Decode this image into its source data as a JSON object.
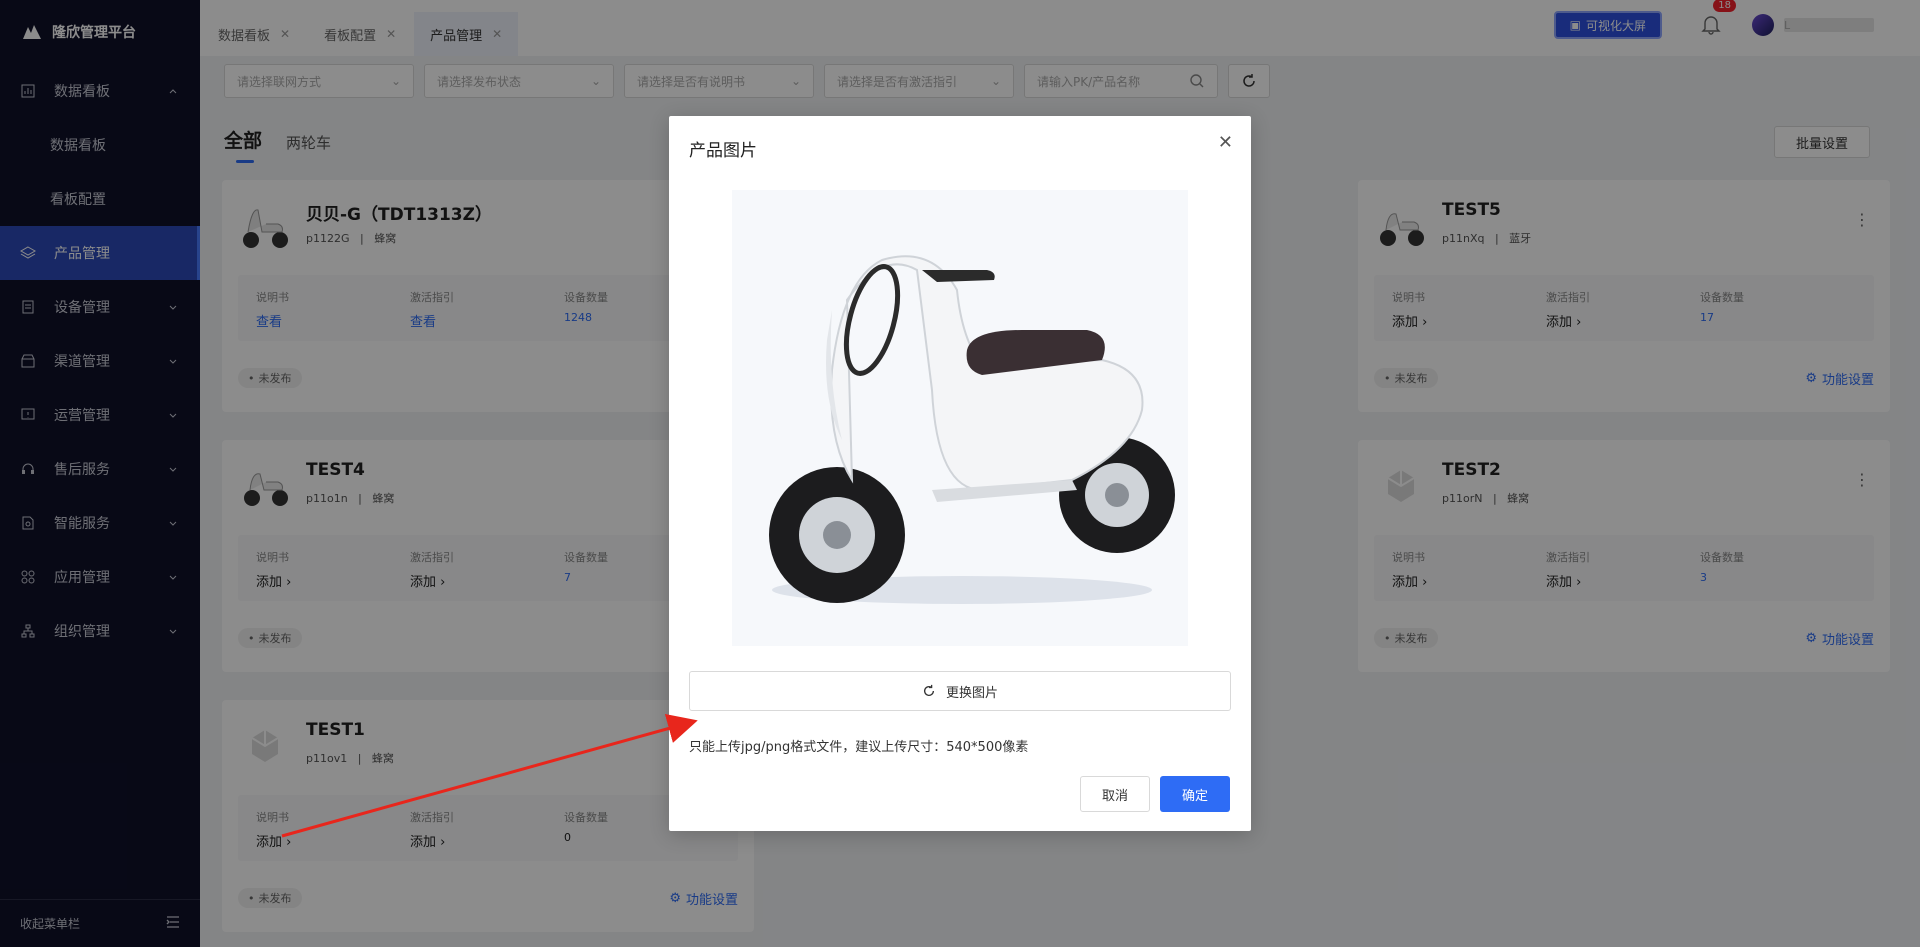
{
  "app": {
    "title": "隆欣管理平台"
  },
  "sidebar": {
    "items": [
      {
        "label": "数据看板",
        "icon": "chart-icon",
        "expanded": true
      },
      {
        "label": "数据看板",
        "sub": true
      },
      {
        "label": "看板配置",
        "sub": true
      },
      {
        "label": "产品管理",
        "icon": "layers-icon",
        "active": true
      },
      {
        "label": "设备管理",
        "icon": "device-icon"
      },
      {
        "label": "渠道管理",
        "icon": "store-icon"
      },
      {
        "label": "运营管理",
        "icon": "ops-icon"
      },
      {
        "label": "售后服务",
        "icon": "headset-icon"
      },
      {
        "label": "智能服务",
        "icon": "doc-icon"
      },
      {
        "label": "应用管理",
        "icon": "apps-icon"
      },
      {
        "label": "组织管理",
        "icon": "org-icon"
      }
    ],
    "collapse_label": "收起菜单栏"
  },
  "tabs": [
    {
      "label": "数据看板"
    },
    {
      "label": "看板配置"
    },
    {
      "label": "产品管理",
      "active": true
    }
  ],
  "header": {
    "bigscreen_label": "可视化大屏",
    "notification_count": "18",
    "username": "L"
  },
  "filters": {
    "network_placeholder": "请选择联网方式",
    "publish_placeholder": "请选择发布状态",
    "manual_placeholder": "请选择是否有说明书",
    "guide_placeholder": "请选择是否有激活指引",
    "search_placeholder": "请输入PK/产品名称"
  },
  "categories": [
    {
      "label": "全部",
      "active": true
    },
    {
      "label": "两轮车"
    }
  ],
  "batch_label": "批量设置",
  "card_labels": {
    "manual": "说明书",
    "guide": "激活指引",
    "devices": "设备数量",
    "func": "功能设置"
  },
  "cards": [
    {
      "name": "贝贝-G（TDT1313Z）",
      "pk": "p1122G",
      "network": "蜂窝",
      "manual": "查看",
      "guide": "查看",
      "devices": "1248",
      "status": "未发布"
    },
    {
      "name": "TEST5",
      "pk": "p11nXq",
      "network": "蓝牙",
      "manual": "添加",
      "guide": "添加",
      "devices": "17",
      "status": "未发布"
    },
    {
      "name": "TEST4",
      "pk": "p11o1n",
      "network": "蜂窝",
      "manual": "添加",
      "guide": "添加",
      "devices": "7",
      "status": "未发布"
    },
    {
      "name": "TEST2",
      "pk": "p11orN",
      "network": "蜂窝",
      "manual": "添加",
      "guide": "添加",
      "devices": "3",
      "status": "未发布"
    },
    {
      "name": "TEST1",
      "pk": "p11ov1",
      "network": "蜂窝",
      "manual": "添加",
      "guide": "添加",
      "devices": "0",
      "status": "未发布"
    }
  ],
  "modal": {
    "title": "产品图片",
    "replace_label": "更换图片",
    "hint": "只能上传jpg/png格式文件，建议上传尺寸：540*500像素",
    "cancel_label": "取消",
    "ok_label": "确定"
  },
  "colors": {
    "primary": "#2e6cf5",
    "sidebar_bg": "#0f1129",
    "sidebar_active": "#2d4ab8",
    "annotation_arrow": "#e8261c"
  }
}
